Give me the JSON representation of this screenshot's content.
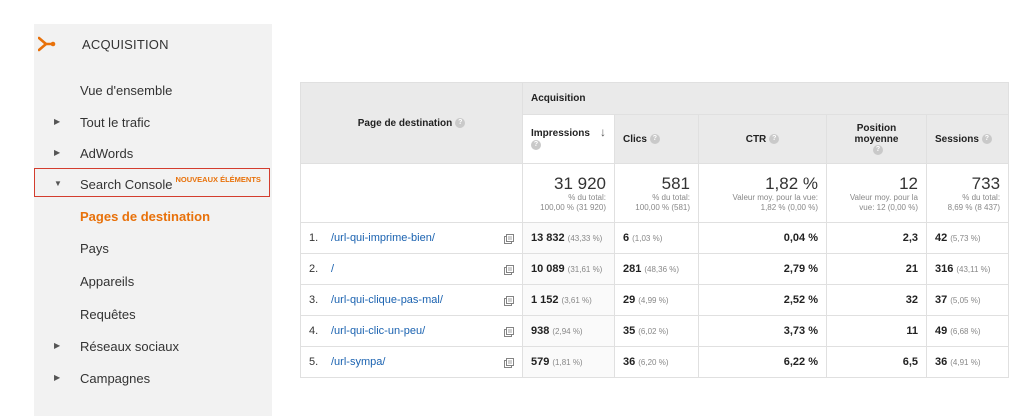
{
  "sidebar": {
    "title": "ACQUISITION",
    "items": [
      {
        "label": "Vue d'ensemble",
        "arrow": ""
      },
      {
        "label": "Tout le trafic",
        "arrow": "▶"
      },
      {
        "label": "AdWords",
        "arrow": "▶"
      },
      {
        "label": "Search Console",
        "arrow": "▼",
        "badge": "NOUVEAUX ÉLÉMENTS"
      },
      {
        "label": "Pages de destination",
        "arrow": ""
      },
      {
        "label": "Pays",
        "arrow": ""
      },
      {
        "label": "Appareils",
        "arrow": ""
      },
      {
        "label": "Requêtes",
        "arrow": ""
      },
      {
        "label": "Réseaux sociaux",
        "arrow": "▶"
      },
      {
        "label": "Campagnes",
        "arrow": "▶"
      }
    ],
    "accent_color": "#e8710a"
  },
  "table": {
    "dim_header": "Page de destination",
    "group_header": "Acquisition",
    "help_glyph": "?",
    "sort_glyph": "↓",
    "columns": [
      "Impressions",
      "Clics",
      "CTR",
      "Position moyenne",
      "Sessions"
    ],
    "summary": [
      {
        "big": "31 920",
        "sub1": "% du total:",
        "sub2": "100,00 % (31 920)"
      },
      {
        "big": "581",
        "sub1": "% du total:",
        "sub2": "100,00 % (581)"
      },
      {
        "big": "1,82 %",
        "sub1": "Valeur moy. pour la vue:",
        "sub2": "1,82 % (0,00 %)"
      },
      {
        "big": "12",
        "sub1": "Valeur moy. pour la",
        "sub2": "vue: 12 (0,00 %)"
      },
      {
        "big": "733",
        "sub1": "% du total:",
        "sub2": "8,69 % (8 437)"
      }
    ],
    "rows": [
      {
        "rank": "1.",
        "page": "/url-qui-imprime-bien/",
        "imp": "13 832",
        "imp_pct": "(43,33 %)",
        "clics": "6",
        "clics_pct": "(1,03 %)",
        "ctr": "0,04 %",
        "pos": "2,3",
        "sess": "42",
        "sess_pct": "(5,73 %)"
      },
      {
        "rank": "2.",
        "page": "/",
        "imp": "10 089",
        "imp_pct": "(31,61 %)",
        "clics": "281",
        "clics_pct": "(48,36 %)",
        "ctr": "2,79 %",
        "pos": "21",
        "sess": "316",
        "sess_pct": "(43,11 %)"
      },
      {
        "rank": "3.",
        "page": "/url-qui-clique-pas-mal/",
        "imp": "1 152",
        "imp_pct": "(3,61 %)",
        "clics": "29",
        "clics_pct": "(4,99 %)",
        "ctr": "2,52 %",
        "pos": "32",
        "sess": "37",
        "sess_pct": "(5,05 %)"
      },
      {
        "rank": "4.",
        "page": "/url-qui-clic-un-peu/",
        "imp": "938",
        "imp_pct": "(2,94 %)",
        "clics": "35",
        "clics_pct": "(6,02 %)",
        "ctr": "3,73 %",
        "pos": "11",
        "sess": "49",
        "sess_pct": "(6,68 %)"
      },
      {
        "rank": "5.",
        "page": "/url-sympa/",
        "imp": "579",
        "imp_pct": "(1,81 %)",
        "clics": "36",
        "clics_pct": "(6,20 %)",
        "ctr": "6,22 %",
        "pos": "6,5",
        "sess": "36",
        "sess_pct": "(4,91 %)"
      }
    ]
  }
}
